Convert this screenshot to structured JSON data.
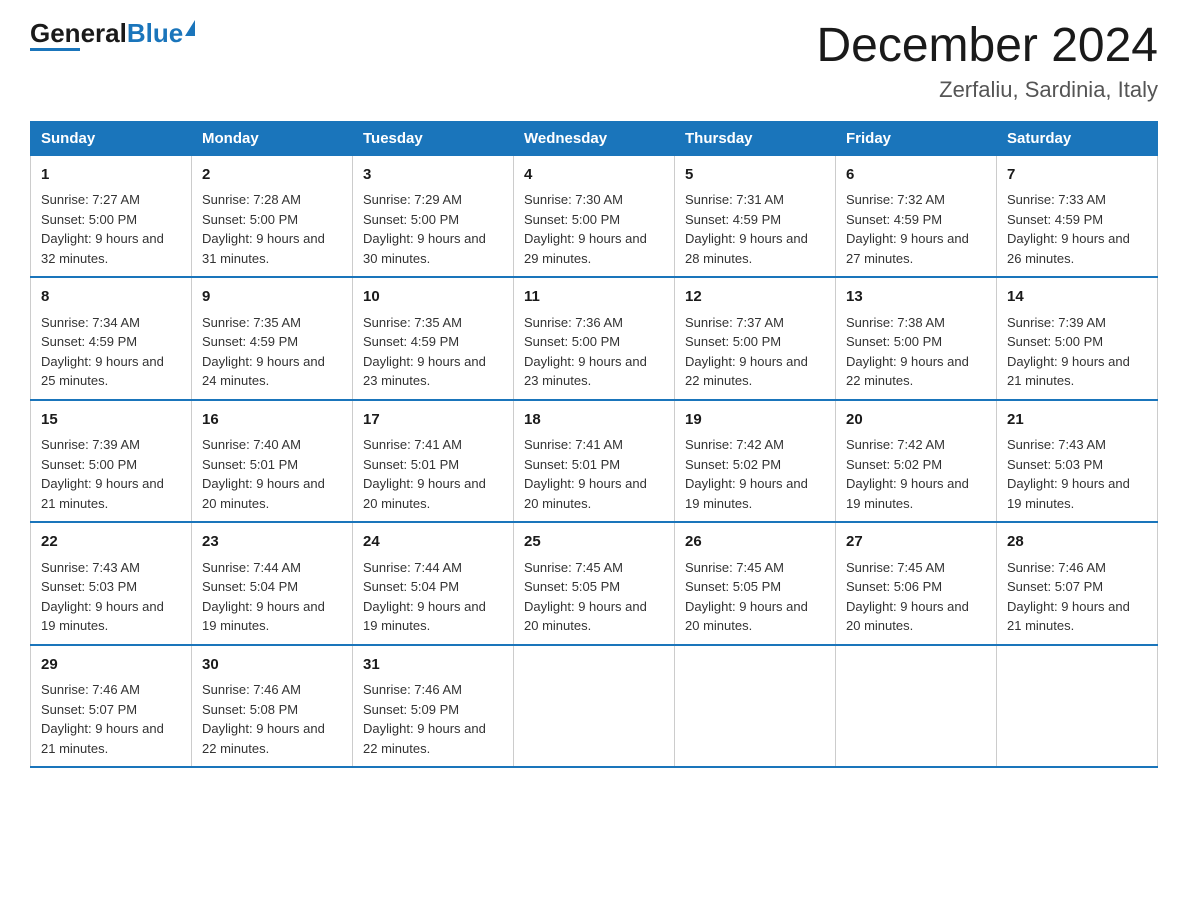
{
  "header": {
    "logo_general": "General",
    "logo_blue": "Blue",
    "title": "December 2024",
    "location": "Zerfaliu, Sardinia, Italy"
  },
  "columns": [
    "Sunday",
    "Monday",
    "Tuesday",
    "Wednesday",
    "Thursday",
    "Friday",
    "Saturday"
  ],
  "weeks": [
    [
      {
        "day": "1",
        "sunrise": "Sunrise: 7:27 AM",
        "sunset": "Sunset: 5:00 PM",
        "daylight": "Daylight: 9 hours and 32 minutes."
      },
      {
        "day": "2",
        "sunrise": "Sunrise: 7:28 AM",
        "sunset": "Sunset: 5:00 PM",
        "daylight": "Daylight: 9 hours and 31 minutes."
      },
      {
        "day": "3",
        "sunrise": "Sunrise: 7:29 AM",
        "sunset": "Sunset: 5:00 PM",
        "daylight": "Daylight: 9 hours and 30 minutes."
      },
      {
        "day": "4",
        "sunrise": "Sunrise: 7:30 AM",
        "sunset": "Sunset: 5:00 PM",
        "daylight": "Daylight: 9 hours and 29 minutes."
      },
      {
        "day": "5",
        "sunrise": "Sunrise: 7:31 AM",
        "sunset": "Sunset: 4:59 PM",
        "daylight": "Daylight: 9 hours and 28 minutes."
      },
      {
        "day": "6",
        "sunrise": "Sunrise: 7:32 AM",
        "sunset": "Sunset: 4:59 PM",
        "daylight": "Daylight: 9 hours and 27 minutes."
      },
      {
        "day": "7",
        "sunrise": "Sunrise: 7:33 AM",
        "sunset": "Sunset: 4:59 PM",
        "daylight": "Daylight: 9 hours and 26 minutes."
      }
    ],
    [
      {
        "day": "8",
        "sunrise": "Sunrise: 7:34 AM",
        "sunset": "Sunset: 4:59 PM",
        "daylight": "Daylight: 9 hours and 25 minutes."
      },
      {
        "day": "9",
        "sunrise": "Sunrise: 7:35 AM",
        "sunset": "Sunset: 4:59 PM",
        "daylight": "Daylight: 9 hours and 24 minutes."
      },
      {
        "day": "10",
        "sunrise": "Sunrise: 7:35 AM",
        "sunset": "Sunset: 4:59 PM",
        "daylight": "Daylight: 9 hours and 23 minutes."
      },
      {
        "day": "11",
        "sunrise": "Sunrise: 7:36 AM",
        "sunset": "Sunset: 5:00 PM",
        "daylight": "Daylight: 9 hours and 23 minutes."
      },
      {
        "day": "12",
        "sunrise": "Sunrise: 7:37 AM",
        "sunset": "Sunset: 5:00 PM",
        "daylight": "Daylight: 9 hours and 22 minutes."
      },
      {
        "day": "13",
        "sunrise": "Sunrise: 7:38 AM",
        "sunset": "Sunset: 5:00 PM",
        "daylight": "Daylight: 9 hours and 22 minutes."
      },
      {
        "day": "14",
        "sunrise": "Sunrise: 7:39 AM",
        "sunset": "Sunset: 5:00 PM",
        "daylight": "Daylight: 9 hours and 21 minutes."
      }
    ],
    [
      {
        "day": "15",
        "sunrise": "Sunrise: 7:39 AM",
        "sunset": "Sunset: 5:00 PM",
        "daylight": "Daylight: 9 hours and 21 minutes."
      },
      {
        "day": "16",
        "sunrise": "Sunrise: 7:40 AM",
        "sunset": "Sunset: 5:01 PM",
        "daylight": "Daylight: 9 hours and 20 minutes."
      },
      {
        "day": "17",
        "sunrise": "Sunrise: 7:41 AM",
        "sunset": "Sunset: 5:01 PM",
        "daylight": "Daylight: 9 hours and 20 minutes."
      },
      {
        "day": "18",
        "sunrise": "Sunrise: 7:41 AM",
        "sunset": "Sunset: 5:01 PM",
        "daylight": "Daylight: 9 hours and 20 minutes."
      },
      {
        "day": "19",
        "sunrise": "Sunrise: 7:42 AM",
        "sunset": "Sunset: 5:02 PM",
        "daylight": "Daylight: 9 hours and 19 minutes."
      },
      {
        "day": "20",
        "sunrise": "Sunrise: 7:42 AM",
        "sunset": "Sunset: 5:02 PM",
        "daylight": "Daylight: 9 hours and 19 minutes."
      },
      {
        "day": "21",
        "sunrise": "Sunrise: 7:43 AM",
        "sunset": "Sunset: 5:03 PM",
        "daylight": "Daylight: 9 hours and 19 minutes."
      }
    ],
    [
      {
        "day": "22",
        "sunrise": "Sunrise: 7:43 AM",
        "sunset": "Sunset: 5:03 PM",
        "daylight": "Daylight: 9 hours and 19 minutes."
      },
      {
        "day": "23",
        "sunrise": "Sunrise: 7:44 AM",
        "sunset": "Sunset: 5:04 PM",
        "daylight": "Daylight: 9 hours and 19 minutes."
      },
      {
        "day": "24",
        "sunrise": "Sunrise: 7:44 AM",
        "sunset": "Sunset: 5:04 PM",
        "daylight": "Daylight: 9 hours and 19 minutes."
      },
      {
        "day": "25",
        "sunrise": "Sunrise: 7:45 AM",
        "sunset": "Sunset: 5:05 PM",
        "daylight": "Daylight: 9 hours and 20 minutes."
      },
      {
        "day": "26",
        "sunrise": "Sunrise: 7:45 AM",
        "sunset": "Sunset: 5:05 PM",
        "daylight": "Daylight: 9 hours and 20 minutes."
      },
      {
        "day": "27",
        "sunrise": "Sunrise: 7:45 AM",
        "sunset": "Sunset: 5:06 PM",
        "daylight": "Daylight: 9 hours and 20 minutes."
      },
      {
        "day": "28",
        "sunrise": "Sunrise: 7:46 AM",
        "sunset": "Sunset: 5:07 PM",
        "daylight": "Daylight: 9 hours and 21 minutes."
      }
    ],
    [
      {
        "day": "29",
        "sunrise": "Sunrise: 7:46 AM",
        "sunset": "Sunset: 5:07 PM",
        "daylight": "Daylight: 9 hours and 21 minutes."
      },
      {
        "day": "30",
        "sunrise": "Sunrise: 7:46 AM",
        "sunset": "Sunset: 5:08 PM",
        "daylight": "Daylight: 9 hours and 22 minutes."
      },
      {
        "day": "31",
        "sunrise": "Sunrise: 7:46 AM",
        "sunset": "Sunset: 5:09 PM",
        "daylight": "Daylight: 9 hours and 22 minutes."
      },
      null,
      null,
      null,
      null
    ]
  ]
}
